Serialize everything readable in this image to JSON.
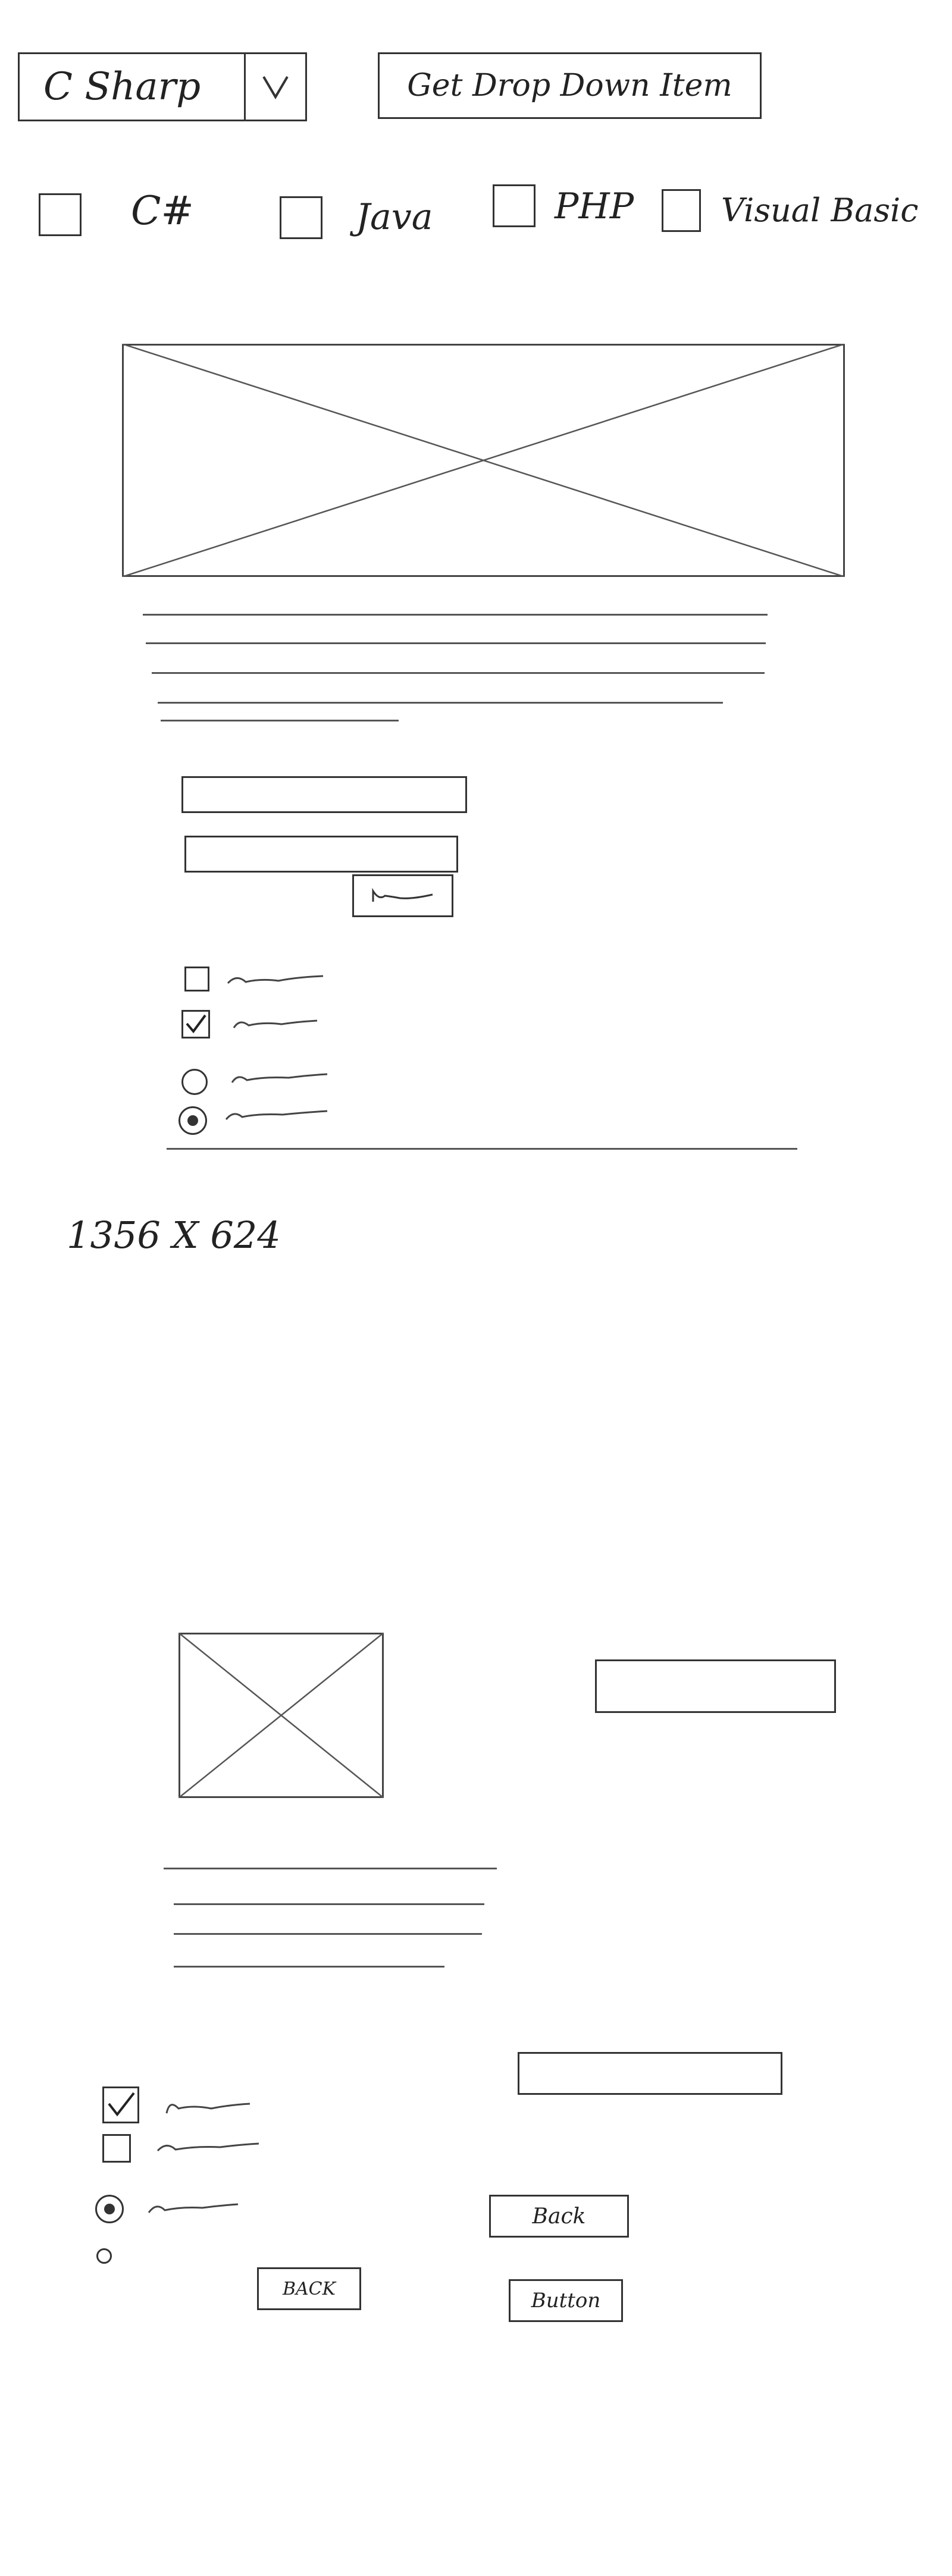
{
  "top_bar": {
    "dropdown_value": "C Sharp",
    "get_button_label": "Get Drop Down Item"
  },
  "languages": [
    {
      "label": "C#",
      "checked": false
    },
    {
      "label": "Java",
      "checked": false
    },
    {
      "label": "PHP",
      "checked": false
    },
    {
      "label": "Visual Basic",
      "checked": false
    }
  ],
  "sketch1": {
    "resolution_note": "1356 X 624",
    "checkbox_states": [
      false,
      true
    ],
    "radio_states": [
      false,
      true
    ]
  },
  "sketch2": {
    "checkbox_states": [
      true,
      false
    ],
    "radio_states": [
      true,
      false
    ],
    "back_button_right": "Back",
    "back_button_left": "BACK",
    "button_label": "Button"
  }
}
